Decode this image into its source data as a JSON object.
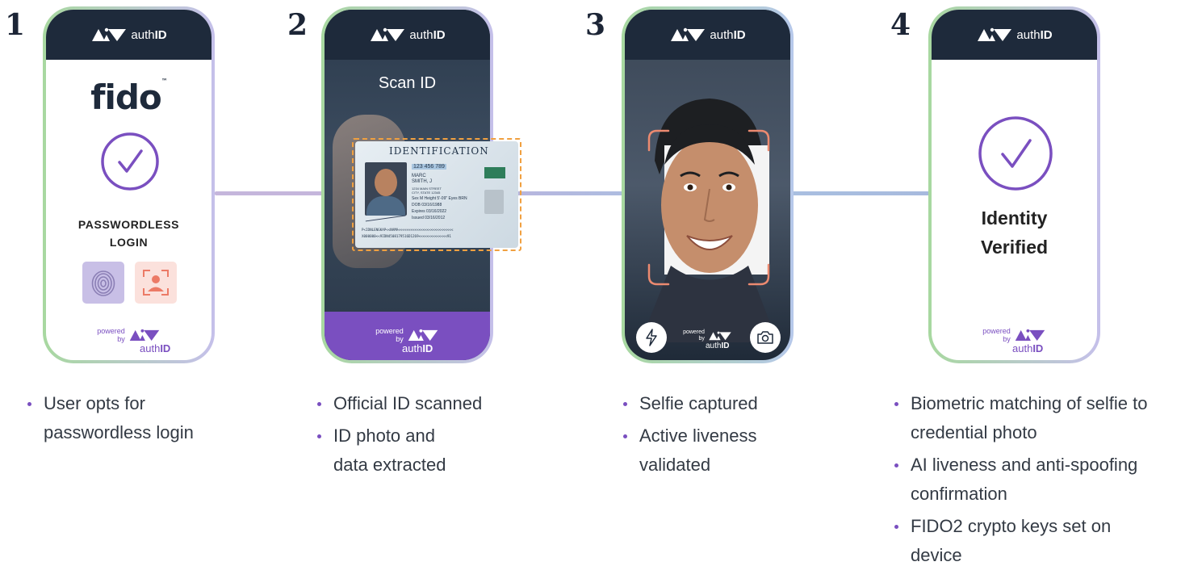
{
  "brand": {
    "name_light": "auth",
    "name_bold": "ID",
    "powered": "powered",
    "by": "by"
  },
  "colors": {
    "accent_purple": "#7a4fc0",
    "header_navy": "#1e2a3b",
    "fido_yellow": "#f7b21a",
    "face_frame": "#ec8a70"
  },
  "steps": [
    {
      "number": "1",
      "fido_logo": "fido",
      "screen_title": "PASSWORDLESS LOGIN",
      "icons": [
        "check-circle-icon",
        "fingerprint-icon",
        "face-id-icon"
      ],
      "bullets": [
        "User opts for passwordless login"
      ]
    },
    {
      "number": "2",
      "screen_title": "Scan ID",
      "id_card": {
        "title": "IDENTIFICATION",
        "number": "123 456 789",
        "name_first": "MARC",
        "name_last": "SMITH, J",
        "address_1": "1234 MAIN STREET",
        "address_2": "CITY, STATE 12345",
        "details": "Sex M  Height 5'-09\"  Eyes BRN",
        "dob": "DOB 03/16/1988",
        "expires": "Expires 03/16/2022",
        "issued": "Issued 03/16/2012",
        "mrz_1": "P<IDNLENGKAP<<NAMA<<<<<<<<<<<<<<<<<<<<<<<<<<<",
        "mrz_2": "X000000<<9IDN4508179516D1269<<<<<<<<<<<<<<91"
      },
      "bullets": [
        "Official ID scanned",
        "ID photo and data extracted"
      ]
    },
    {
      "number": "3",
      "icons": [
        "flash-icon",
        "camera-icon"
      ],
      "bullets": [
        "Selfie captured",
        "Active liveness validated"
      ]
    },
    {
      "number": "4",
      "screen_title_1": "Identity",
      "screen_title_2": "Verified",
      "icons": [
        "check-circle-icon"
      ],
      "bullets": [
        "Biometric matching of selfie to credential photo",
        "AI liveness and anti-spoofing confirmation",
        "FIDO2 crypto keys set on device"
      ]
    }
  ]
}
